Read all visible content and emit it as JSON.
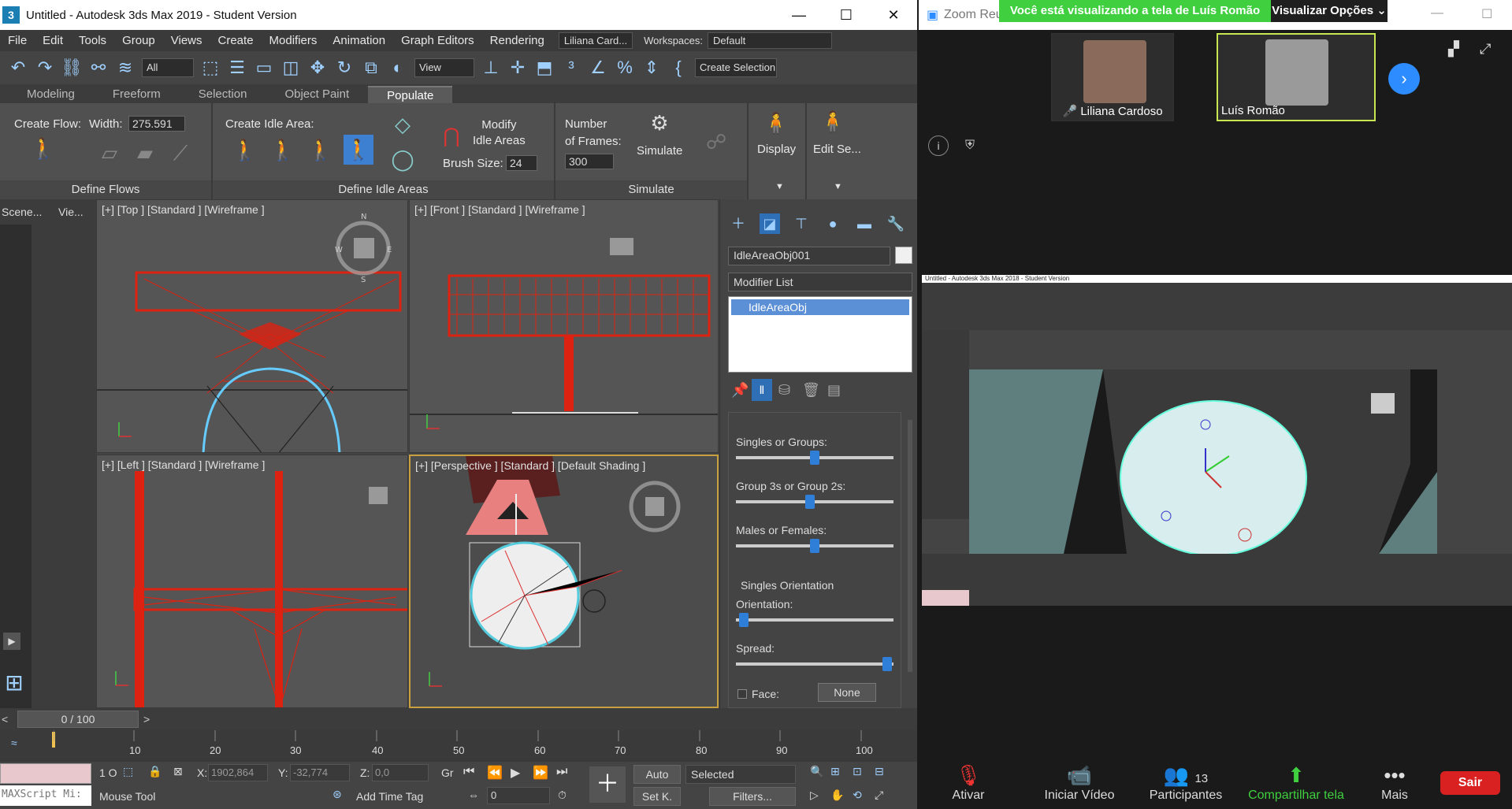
{
  "window": {
    "title": "Untitled - Autodesk 3ds Max 2019 - Student Version",
    "icon": "3"
  },
  "menu": [
    "File",
    "Edit",
    "Tools",
    "Group",
    "Views",
    "Create",
    "Modifiers",
    "Animation",
    "Graph Editors",
    "Rendering"
  ],
  "user": "Liliana Card...",
  "workspaces_label": "Workspaces:",
  "workspaces_value": "Default",
  "toolbar": {
    "filter": "All",
    "ref_coord": "View",
    "create_selection": "Create Selection S"
  },
  "ribbon_tabs": [
    "Modeling",
    "Freeform",
    "Selection",
    "Object Paint",
    "Populate"
  ],
  "ribbon": {
    "create_flow": "Create Flow:",
    "width_label": "Width:",
    "width_value": "275.591",
    "create_idle_area": "Create Idle Area:",
    "modify_idle_areas": "Modify\nIdle Areas",
    "brush_size_label": "Brush Size:",
    "brush_size_value": "24",
    "number_of_frames": "Number\nof Frames:",
    "frames_value": "300",
    "simulate": "Simulate",
    "display": "Display",
    "edit_se": "Edit Se...",
    "panel_define_flows": "Define Flows",
    "panel_define_idle": "Define Idle Areas",
    "panel_simulate": "Simulate"
  },
  "scene_tabs": [
    "Scene...",
    "Vie..."
  ],
  "viewports": {
    "top": "[+] [Top ] [Standard ] [Wireframe ]",
    "front": "[+] [Front ] [Standard ] [Wireframe ]",
    "left": "[+] [Left ] [Standard ] [Wireframe ]",
    "persp": "[+] [Perspective ] [Standard ] [Default Shading ]"
  },
  "cmd": {
    "object_name": "IdleAreaObj001",
    "modifier_list": "Modifier List",
    "stack_item": "IdleAreaObj",
    "singles_or_groups": "Singles or Groups:",
    "group_3s_2s": "Group 3s or Group 2s:",
    "males_females": "Males or Females:",
    "singles_orientation": "Singles Orientation",
    "orientation": "Orientation:",
    "spread": "Spread:",
    "face": "Face:",
    "none": "None"
  },
  "sliders": {
    "singles_or_groups": 0.5,
    "group_3s_2s": 0.47,
    "males_females": 0.5,
    "orientation": 0.05,
    "spread": 0.96
  },
  "timeline": {
    "counter": "0 / 100",
    "ticks": [
      "10",
      "20",
      "30",
      "40",
      "50",
      "60",
      "70",
      "80",
      "90",
      "100"
    ]
  },
  "status": {
    "maxscript": "MAXScript Mi:",
    "selected_count": "1 O",
    "x_label": "X:",
    "x_value": "1902,864",
    "y_label": "Y:",
    "y_value": "-32,774",
    "z_label": "Z:",
    "z_value": "0,0",
    "grid": "Gr",
    "mouse_tool": "Mouse Tool",
    "add_time_tag": "Add Time Tag",
    "auto": "Auto",
    "set_k": "Set K.",
    "selected": "Selected",
    "filters": "Filters...",
    "frame": "0"
  },
  "zoom": {
    "title": "Zoom Reu",
    "share_note": "Você está visualizando a tela de Luís Romão",
    "view_options": "Visualizar Opções",
    "participant1": "Liliana Cardoso",
    "participant2": "Luís Romão",
    "shared_title": "Untitled - Autodesk 3ds Max 2018 - Student Version",
    "controls": {
      "mute": "Ativar",
      "video": "Iniciar Vídeo",
      "participants": "Participantes",
      "participants_count": "13",
      "share": "Compartilhar tela",
      "more": "Mais",
      "leave": "Sair"
    }
  }
}
